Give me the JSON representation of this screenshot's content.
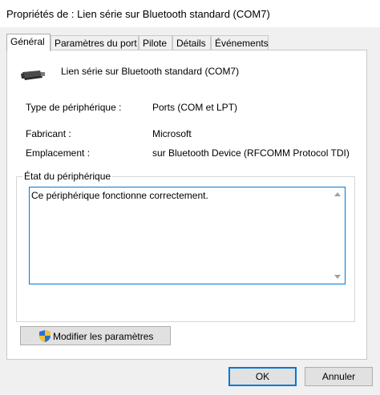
{
  "window": {
    "title": "Propriétés de : Lien série sur Bluetooth standard (COM7)"
  },
  "tabs": [
    {
      "label": "Général"
    },
    {
      "label": "Paramètres du port"
    },
    {
      "label": "Pilote"
    },
    {
      "label": "Détails"
    },
    {
      "label": "Événements"
    }
  ],
  "device": {
    "name": "Lien série sur Bluetooth standard (COM7)",
    "icon": "serial-port-icon"
  },
  "properties": [
    {
      "label": "Type de périphérique :",
      "value": "Ports (COM et LPT)"
    },
    {
      "label": "Fabricant :",
      "value": "Microsoft"
    },
    {
      "label": "Emplacement :",
      "value": "sur Bluetooth Device (RFCOMM Protocol TDI)"
    }
  ],
  "status": {
    "group_label": "État du périphérique",
    "text": "Ce périphérique fonctionne correctement."
  },
  "change_settings": {
    "label": "Modifier les paramètres",
    "icon": "uac-shield-icon"
  },
  "buttons": {
    "ok": "OK",
    "cancel": "Annuler"
  },
  "colors": {
    "focus": "#0078d7",
    "button": "#e1e1e1",
    "window_bg": "#f0f0f0"
  }
}
